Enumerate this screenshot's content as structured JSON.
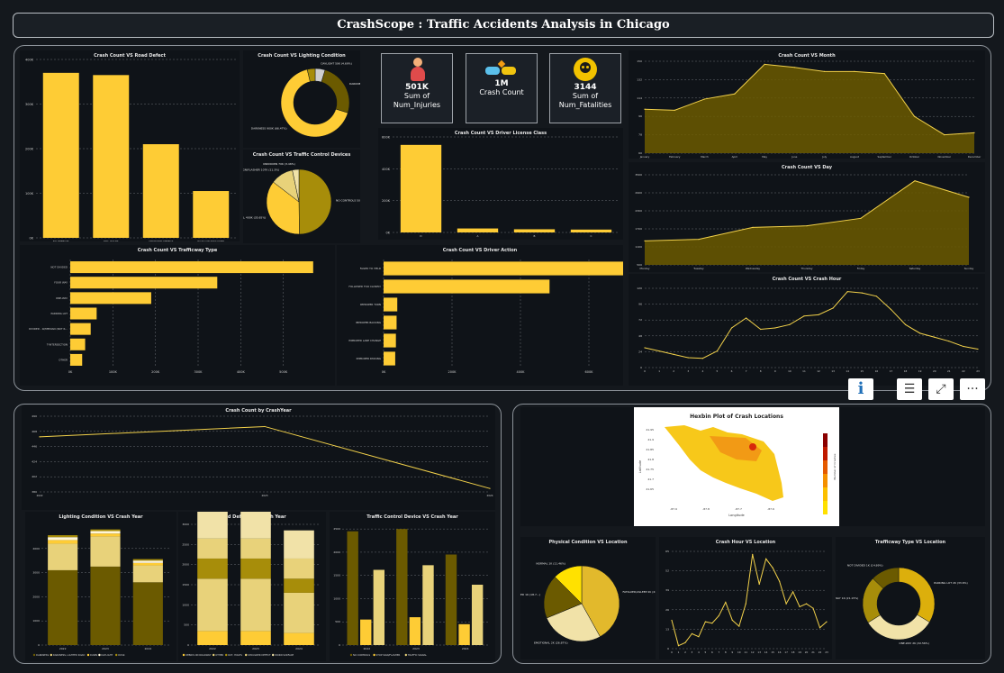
{
  "header": {
    "title": "CrashScope : Traffic Accidents Analysis in Chicago"
  },
  "kpis": [
    {
      "value": "501K",
      "label1": "Sum of",
      "label2": "Num_Injuries",
      "icon": "injured-person-icon"
    },
    {
      "value": "1M",
      "label1": "Crash Count",
      "label2": "",
      "icon": "car-crash-icon"
    },
    {
      "value": "3144",
      "label1": "Sum of",
      "label2": "Num_Fatalities",
      "icon": "skull-icon"
    }
  ],
  "toolbar": {
    "info": "i",
    "filter": "☰",
    "expand": "⤢",
    "more": "···"
  },
  "colors": {
    "gold": "#fecc35",
    "dark_olive": "#6b5a00",
    "mid_olive": "#a78d0a",
    "light_gold": "#e8d27a",
    "pale": "#f1e2a8",
    "cream": "#fff6d8",
    "grid": "#6a6f75",
    "bg": "#0f1318"
  },
  "chart_data": [
    {
      "id": "road_defect",
      "type": "bar",
      "title": "Crash Count VS Road Defect",
      "categories": [
        "NO DEFECTS",
        "DRY, HOLES",
        "UNKNOWN DEFECT",
        "ROAD ON SHOULDER"
      ],
      "values": [
        370,
        365,
        210,
        105
      ],
      "ylim": [
        0,
        400
      ],
      "yticks": [
        "0K",
        "100K",
        "200K",
        "300K",
        "400K"
      ]
    },
    {
      "id": "lighting",
      "type": "pie",
      "title": "Crash Count VS Lighting Condition",
      "donut": true,
      "slices": [
        {
          "label": "DAYLIGHT 50K (4.69%)",
          "value": 4.69,
          "color": "#cfcfcf"
        },
        {
          "label": "DARKNESS, LIGHTE... 300K (25.1%)",
          "value": 25.1,
          "color": "#6b5a00"
        },
        {
          "label": "DARKNESS 900K (66.47%)",
          "value": 66.47,
          "color": "#fecc35"
        },
        {
          "label": "DAWN",
          "value": 3.74,
          "color": "#a78d0a"
        }
      ]
    },
    {
      "id": "traffic_control",
      "type": "pie",
      "title": "Crash Count VS Traffic Control Devices",
      "slices": [
        {
          "label": "NO CONTROLS 500K (49.77%)",
          "value": 49.77,
          "color": "#a78d0a"
        },
        {
          "label": "TRAFFIC SIGNAL 400K (35.65%)",
          "value": 35.65,
          "color": "#fecc35"
        },
        {
          "label": "STOP SIGN/FLASHER 107K (11.3%)",
          "value": 11.3,
          "color": "#e8d27a"
        },
        {
          "label": "UNKNOWN 70K (3.46%)",
          "value": 3.28,
          "color": "#f1e2a8"
        }
      ]
    },
    {
      "id": "license",
      "type": "bar",
      "title": "Crash Count VS Driver License Class",
      "categories": [
        "D",
        "A",
        "B",
        "C"
      ],
      "values": [
        550,
        25,
        20,
        18
      ],
      "ylim": [
        0,
        600
      ],
      "yticks": [
        "0K",
        "200K",
        "400K",
        "600K"
      ]
    },
    {
      "id": "month",
      "type": "area",
      "title": "Crash Count VS Month",
      "categories": [
        "January",
        "February",
        "March",
        "April",
        "May",
        "June",
        "July",
        "August",
        "September",
        "October",
        "November",
        "December"
      ],
      "values": [
        103,
        102,
        113,
        118,
        147,
        144,
        140,
        140,
        138,
        96,
        78,
        80
      ],
      "ylim": [
        60,
        150
      ]
    },
    {
      "id": "day",
      "type": "area",
      "title": "Crash Count VS Day",
      "categories": [
        "Monday",
        "Tuesday",
        "Wednesday",
        "Thursday",
        "Friday",
        "Saturday",
        "Sunday"
      ],
      "values": [
        1300,
        1350,
        1750,
        1800,
        2050,
        3300,
        2750
      ],
      "ylim": [
        500,
        3500
      ]
    },
    {
      "id": "trafficway",
      "type": "hbar",
      "title": "Crash Count VS Trafficway Type",
      "categories": [
        "NOT DIVIDED",
        "FOUR WAY",
        "ONE-WAY",
        "PARKING LOT",
        "DIVIDED - W/MEDIAN (NOT R...",
        "T-INTERSECTION",
        "OTHER"
      ],
      "values": [
        570,
        345,
        190,
        62,
        48,
        35,
        28
      ],
      "xlim": [
        0,
        600
      ],
      "xticks": [
        "0K",
        "100K",
        "200K",
        "300K",
        "400K",
        "500K"
      ]
    },
    {
      "id": "driver_action",
      "type": "hbar",
      "title": "Crash Count VS Driver Action",
      "categories": [
        "FAILED TO YIELD",
        "FOLLOWED TOO CLOSELY",
        "IMPROPER TURN",
        "IMPROPER BACKING",
        "IMPROPER LANE CHANGE",
        "IMPROPER PASSING"
      ],
      "values": [
        700,
        485,
        40,
        38,
        36,
        34
      ],
      "xlim": [
        0,
        700
      ],
      "xticks": [
        "0K",
        "200K",
        "400K",
        "600K"
      ]
    },
    {
      "id": "crash_hour",
      "type": "line",
      "title": "Crash Count VS Crash Hour",
      "x": [
        0,
        1,
        2,
        3,
        4,
        5,
        6,
        7,
        8,
        9,
        10,
        11,
        12,
        13,
        14,
        15,
        16,
        17,
        18,
        19,
        20,
        21,
        22,
        23
      ],
      "values": [
        30,
        25,
        20,
        15,
        14,
        25,
        60,
        75,
        58,
        60,
        65,
        78,
        80,
        90,
        115,
        113,
        108,
        88,
        65,
        52,
        46,
        40,
        32,
        28
      ],
      "ylim": [
        0,
        120
      ]
    },
    {
      "id": "year",
      "type": "line",
      "title": "Crash Count by CrashYear",
      "categories": [
        "2022",
        "2023",
        "2024"
      ],
      "values": [
        460,
        475,
        385
      ],
      "ylim": [
        380,
        490
      ]
    },
    {
      "id": "lighting_year",
      "type": "stacked-bar",
      "title": "Lighting Condition VS Crash Year",
      "categories": [
        "2022",
        "2023",
        "2024"
      ],
      "series": [
        {
          "name": "DARKNESS",
          "values": [
            3100,
            3250,
            2600
          ],
          "color": "#6b5a00"
        },
        {
          "name": "DARKNESS, LIGHTED ROAD",
          "values": [
            1100,
            1250,
            700
          ],
          "color": "#e8d27a"
        },
        {
          "name": "DAWN",
          "values": [
            150,
            120,
            100
          ],
          "color": "#fecc35"
        },
        {
          "name": "DAYLIGHT",
          "values": [
            120,
            100,
            100
          ],
          "color": "#fff6d8"
        },
        {
          "name": "DUSK",
          "values": [
            80,
            70,
            60
          ],
          "color": "#a78d0a"
        }
      ],
      "ylim": [
        0,
        5000
      ],
      "yticks": [
        "0",
        "1000",
        "2000",
        "3000",
        "4000"
      ]
    },
    {
      "id": "road_defect_year",
      "type": "stacked-bar",
      "title": "Road Defect VS Crash Year",
      "categories": [
        "2022",
        "2023",
        "2024"
      ],
      "series": [
        {
          "name": "DEBRIS ON ROADWAY",
          "values": [
            350,
            350,
            300
          ],
          "color": "#fecc35"
        },
        {
          "name": "OTHER",
          "values": [
            1300,
            1300,
            1000
          ],
          "color": "#e8d27a"
        },
        {
          "name": "RUT, HOLES",
          "values": [
            500,
            500,
            350
          ],
          "color": "#a78d0a"
        },
        {
          "name": "SHOULDER DEFECT",
          "values": [
            500,
            500,
            500
          ],
          "color": "#e8d27a"
        },
        {
          "name": "WORN SURFACE",
          "values": [
            800,
            800,
            700
          ],
          "color": "#f1e2a8"
        }
      ],
      "ylim": [
        0,
        3000
      ],
      "yticks": [
        "0",
        "500",
        "1000",
        "1500",
        "2000",
        "2500",
        "3000"
      ]
    },
    {
      "id": "traffic_device_year",
      "type": "grouped-bar",
      "title": "Traffic Control Device VS Crash Year",
      "categories": [
        "2022",
        "2023",
        "2024"
      ],
      "series": [
        {
          "name": "NO CONTROLS",
          "values": [
            2450,
            2500,
            1950
          ],
          "color": "#6b5a00"
        },
        {
          "name": "STOP SIGN/FLASHER",
          "values": [
            550,
            600,
            450
          ],
          "color": "#fecc35"
        },
        {
          "name": "TRAFFIC SIGNAL",
          "values": [
            1620,
            1720,
            1300
          ],
          "color": "#e8d27a"
        }
      ],
      "ylim": [
        0,
        2600
      ],
      "yticks": [
        "0",
        "500",
        "1000",
        "1500",
        "2000",
        "2500"
      ]
    },
    {
      "id": "hexbin",
      "type": "heatmap",
      "title": "Hexbin Plot of Crash Locations",
      "xlabel": "Longitude",
      "ylabel": "Latitude",
      "colorbar_label": "Number of Crashes",
      "yticks": [
        "41.95",
        "41.9",
        "41.85",
        "41.8",
        "41.75",
        "41.7",
        "41.65"
      ],
      "xticks": [
        "-87.9",
        "-87.8",
        "-87.7",
        "-87.6"
      ]
    },
    {
      "id": "physical_condition",
      "type": "pie",
      "title": "Physical Condition VS Location",
      "slices": [
        {
          "label": "FATIGUED/ASLEEP 2K (41.91%)",
          "value": 41.91,
          "color": "#e2b92c"
        },
        {
          "label": "EMOTIONAL 2K (26.87%)",
          "value": 26.87,
          "color": "#f1e2a8"
        },
        {
          "label": "ILLNESS/FAINTED 1K (18.7...)",
          "value": 18.7,
          "color": "#6b5a00"
        },
        {
          "label": "NORMAL 1K (11.46%)",
          "value": 12.52,
          "color": "#ffe100"
        }
      ]
    },
    {
      "id": "hour_location",
      "type": "line",
      "title": "Crash Hour VS Location",
      "x": [
        0,
        1,
        2,
        3,
        4,
        5,
        6,
        7,
        8,
        9,
        10,
        11,
        12,
        13,
        14,
        15,
        16,
        17,
        18,
        19,
        20,
        21,
        22,
        23
      ],
      "values": [
        19,
        2,
        4,
        10,
        8,
        18,
        17,
        22,
        31,
        19,
        15,
        30,
        63,
        43,
        60,
        54,
        45,
        30,
        38,
        28,
        30,
        27,
        14,
        18
      ],
      "ylim": [
        0,
        65
      ]
    },
    {
      "id": "trafficway_location",
      "type": "pie",
      "title": "Trafficway Type VS Location",
      "donut": true,
      "slices": [
        {
          "label": "PARKING LOT 2K (33.6%)",
          "value": 33.6,
          "color": "#dcaf0c"
        },
        {
          "label": "ONE-WAY 2K (32.56%)",
          "value": 32.56,
          "color": "#f1e2a8"
        },
        {
          "label": "FOUR WAY 1K (21.15%)",
          "value": 21.15,
          "color": "#a78d0a"
        },
        {
          "label": "NOT DIVIDED 1K (14.89%)",
          "value": 12.69,
          "color": "#6b5a00"
        }
      ]
    }
  ]
}
